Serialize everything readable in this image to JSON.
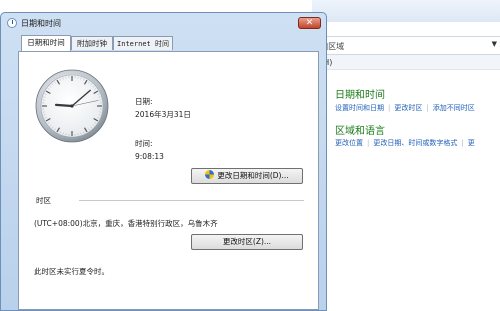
{
  "background_window": {
    "address_text": "]区域",
    "help_menu": "](H)",
    "section1": {
      "heading": "日期和时间",
      "links": [
        "设置时间和日期",
        "更改时区",
        "添加不同时区"
      ]
    },
    "section2": {
      "heading": "区域和语言",
      "links": [
        "更改位置",
        "更改日期、时间或数字格式",
        "更"
      ]
    }
  },
  "dialog": {
    "title": "日期和时间",
    "close_glyph": "✕",
    "tabs": [
      {
        "label": "日期和时间"
      },
      {
        "label": "附加时钟"
      },
      {
        "label": "Internet 时间"
      }
    ],
    "date_label": "日期:",
    "date_value": "2016年3月31日",
    "time_label": "时间:",
    "time_value": "9:08:13",
    "change_datetime_button": "更改日期和时间(D)...",
    "timezone_section_label": "时区",
    "timezone_value": "(UTC+08:00)北京，重庆，香港特别行政区，乌鲁木齐",
    "change_timezone_button": "更改时区(Z)...",
    "dst_note": "此时区未实行夏令时。"
  },
  "clock": {
    "hour": 9,
    "minute": 8,
    "second": 13
  }
}
